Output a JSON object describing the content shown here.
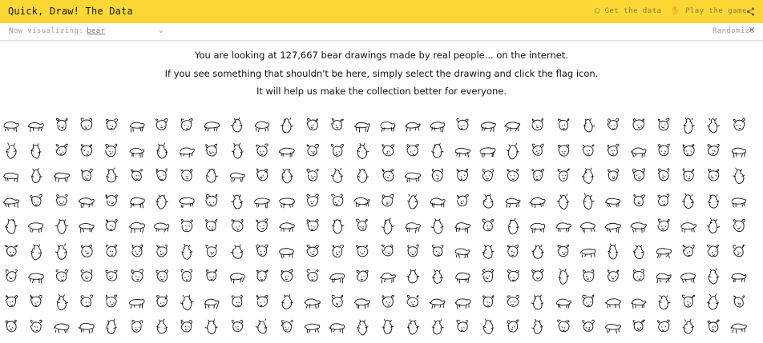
{
  "header": {
    "brand": "Quick, Draw! The Data",
    "links": [
      {
        "label": "Get the data",
        "icon": "github-icon"
      },
      {
        "label": "Play the game",
        "icon": "hand-icon"
      }
    ],
    "background": "#fdd835"
  },
  "subheader": {
    "now_label": "Now visualizing:",
    "now_value": "bear",
    "randomize_label": "Randomize"
  },
  "intro": {
    "line1": "You are looking at 127,667 bear drawings made by real people... on the internet.",
    "line2": "If you see something that shouldn't be here, simply select the drawing and click the flag icon.",
    "line3": "It will help us make the collection better for everyone."
  },
  "drawings": {
    "subject": "bear",
    "visible_count": 270
  }
}
